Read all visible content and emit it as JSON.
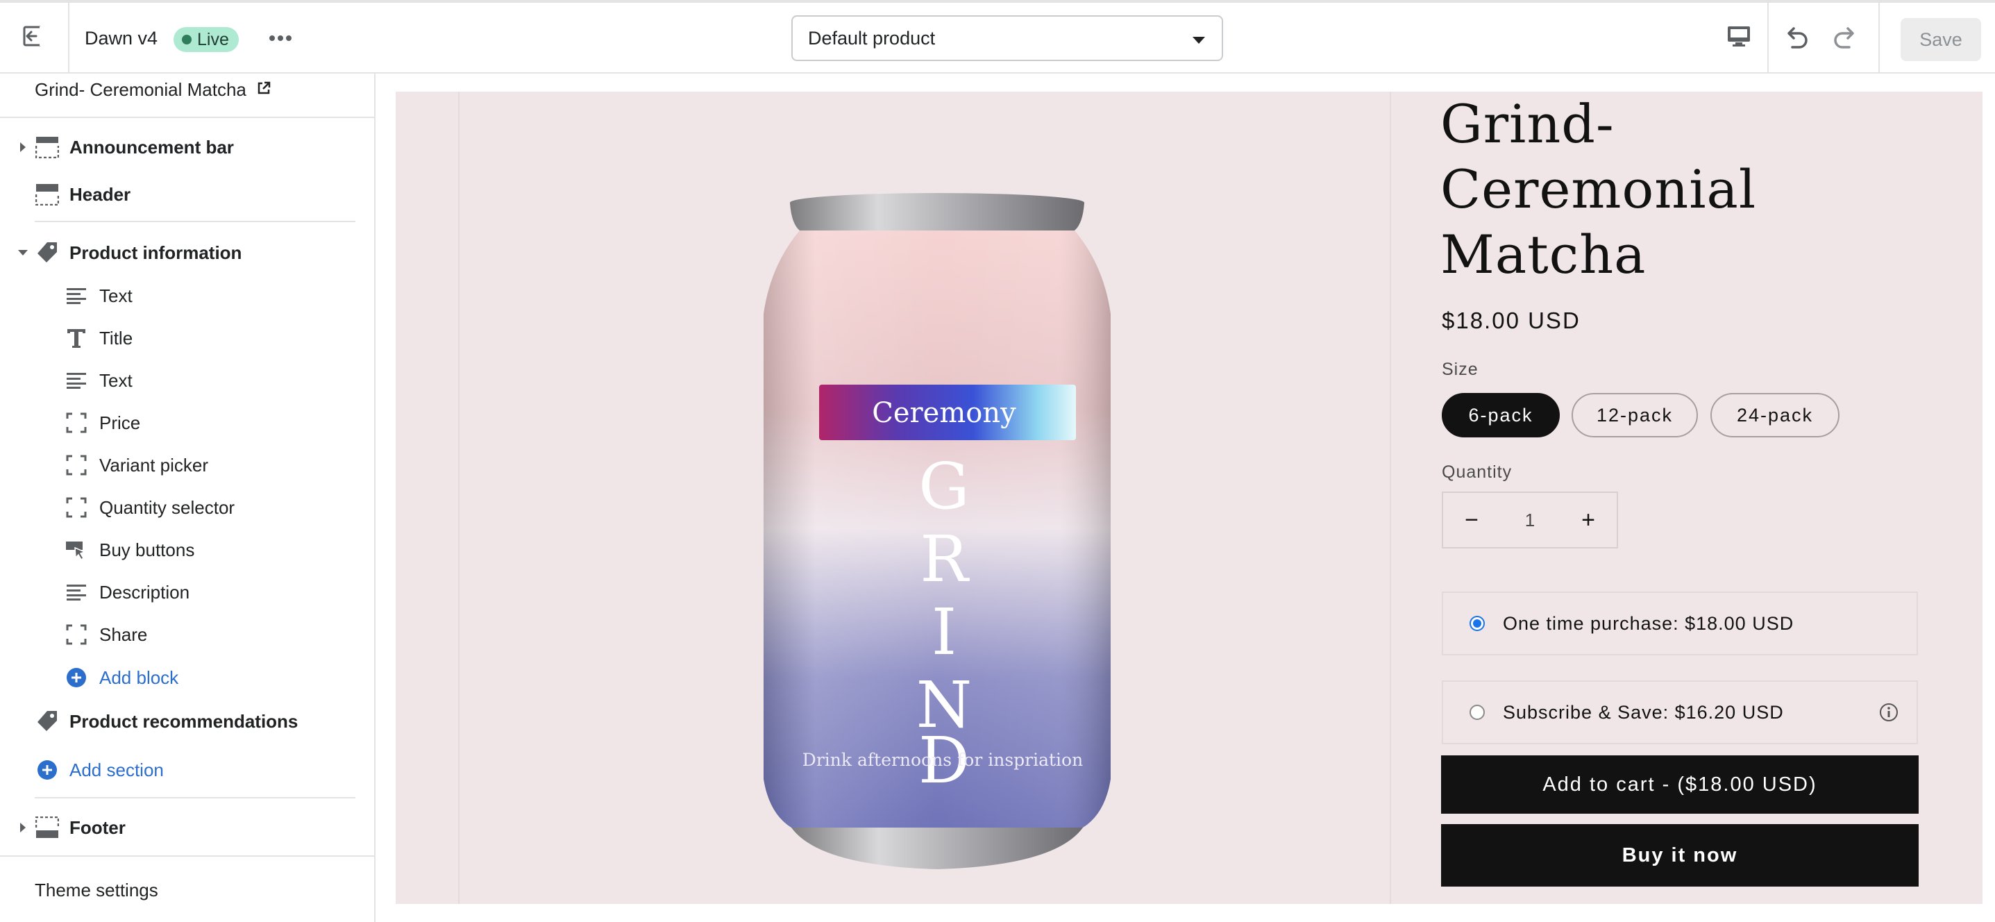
{
  "topbar": {
    "theme_name": "Dawn v4",
    "status_badge": "Live",
    "template_select": "Default product",
    "save_label": "Save",
    "icons": [
      "exit-icon",
      "more-icon",
      "desktop-icon",
      "undo-icon",
      "redo-icon"
    ]
  },
  "sidebar": {
    "page_name": "Grind- Ceremonial Matcha",
    "sections": [
      {
        "label": "Announcement bar",
        "icon": "announcement-bar-icon"
      },
      {
        "label": "Header",
        "icon": "header-icon"
      },
      {
        "label": "Product information",
        "icon": "tag-icon"
      }
    ],
    "blocks": [
      {
        "label": "Text",
        "icon": "text-lines-icon"
      },
      {
        "label": "Title",
        "icon": "title-t-icon"
      },
      {
        "label": "Text",
        "icon": "text-lines-icon"
      },
      {
        "label": "Price",
        "icon": "block-frame-icon"
      },
      {
        "label": "Variant picker",
        "icon": "block-frame-icon"
      },
      {
        "label": "Quantity selector",
        "icon": "block-frame-icon"
      },
      {
        "label": "Buy buttons",
        "icon": "buy-buttons-icon"
      },
      {
        "label": "Description",
        "icon": "text-lines-icon"
      },
      {
        "label": "Share",
        "icon": "block-frame-icon"
      }
    ],
    "add_block": "Add block",
    "product_recommendations": "Product recommendations",
    "add_section": "Add section",
    "footer": "Footer",
    "theme_settings": "Theme settings"
  },
  "product": {
    "title": "Grind- Ceremonial Matcha",
    "price": "$18.00 USD",
    "size_label": "Size",
    "sizes": [
      "6-pack",
      "12-pack",
      "24-pack"
    ],
    "selected_size": "6-pack",
    "quantity_label": "Quantity",
    "quantity": "1",
    "qty_minus": "−",
    "qty_plus": "+",
    "one_time": "One time purchase: $18.00 USD",
    "subscribe": "Subscribe & Save: $16.20 USD",
    "add_to_cart": "Add to cart - ($18.00 USD)",
    "buy_now": "Buy it now",
    "can": {
      "label_band": "Ceremony",
      "brand_letters": [
        "G",
        "R",
        "I",
        "N",
        "D"
      ],
      "tagline": "Drink afternoons for inspriation"
    }
  },
  "colors": {
    "accent_link": "#2c6ecb",
    "live_badge_bg": "#aee9d1",
    "preview_bg": "#f0e6e8",
    "button_dark": "#121212"
  }
}
